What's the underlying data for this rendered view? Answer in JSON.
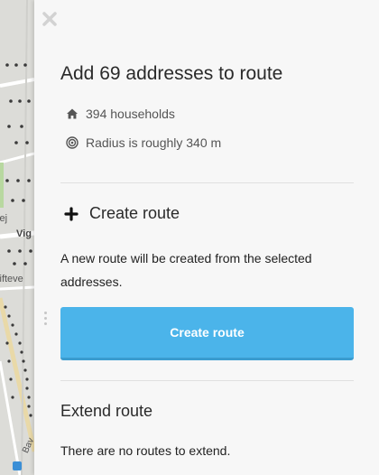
{
  "map": {
    "labels": [
      "vej",
      "Vig",
      "kifteve",
      "Bav"
    ]
  },
  "panel": {
    "title": "Add 69 addresses to route",
    "stats": [
      {
        "icon": "home-icon",
        "text": "394 households"
      },
      {
        "icon": "radius-icon",
        "text": "Radius is roughly 340 m"
      }
    ],
    "create": {
      "heading": "Create route",
      "description": "A new route will be created from the selected addresses.",
      "button_label": "Create route"
    },
    "extend": {
      "heading": "Extend route",
      "message": "There are no routes to extend."
    }
  },
  "colors": {
    "accent": "#4bb4ea",
    "panel_bg": "#f7f7f7"
  }
}
